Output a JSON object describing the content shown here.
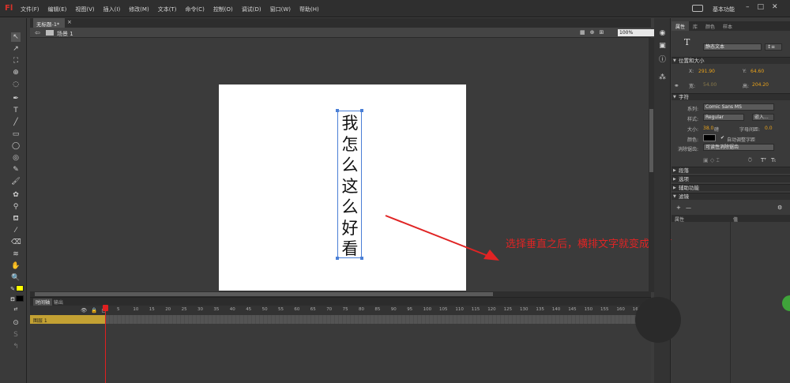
{
  "app": {
    "logo": "Fl",
    "menus": [
      "文件(F)",
      "编辑(E)",
      "视图(V)",
      "插入(I)",
      "修改(M)",
      "文本(T)",
      "命令(C)",
      "控制(O)",
      "调试(D)",
      "窗口(W)",
      "帮助(H)"
    ],
    "workspace_label": "基本功能",
    "window_buttons": [
      "–",
      "□",
      "✕"
    ]
  },
  "document": {
    "tab_label": "无标题-1*",
    "tab_close": "×",
    "back": "⇦",
    "scene_label": "场景 1",
    "zoom_value": "100%",
    "scene_icons": [
      "▦",
      "⊕",
      "⊞"
    ]
  },
  "stage": {
    "vertical_text": [
      "我",
      "怎",
      "么",
      "这",
      "么",
      "好",
      "看"
    ]
  },
  "annotation": {
    "text": "选择垂直之后，横排文字就变成竖排了",
    "color": "#e02424"
  },
  "timeline": {
    "tabs": [
      "时间轴",
      "输出"
    ],
    "header_icons": [
      "👁",
      "🔒",
      "▢"
    ],
    "frame_numbers": [
      "1",
      "5",
      "10",
      "15",
      "20",
      "25",
      "30",
      "35",
      "40",
      "45",
      "50",
      "55",
      "60",
      "65",
      "70",
      "75",
      "80",
      "85",
      "90",
      "95",
      "100",
      "105",
      "110",
      "115",
      "120",
      "125",
      "130",
      "135",
      "140",
      "145",
      "150",
      "155",
      "160",
      "16"
    ],
    "layer_name": "图层 1",
    "layer_color": "#c3a133"
  },
  "tools": {
    "stroke_color": "#ffff00",
    "fill_color": "#000000"
  },
  "properties": {
    "tabs": [
      "属性",
      "库",
      "颜色",
      "样本"
    ],
    "tool_glyph": "T",
    "text_type": "静态文本",
    "orientation_icon": "↕≡",
    "sections": {
      "position": "位置和大小",
      "character": "字符",
      "paragraph": "段落",
      "options": "选项",
      "accessibility": "辅助功能",
      "filters": "滤镜"
    },
    "x_label": "X:",
    "x_value": "291.90",
    "y_label": "Y:",
    "y_value": "64.60",
    "w_label": "宽:",
    "w_value": "54.00",
    "h_label": "高:",
    "h_value": "204.20",
    "family_label": "系列:",
    "family_value": "Comic Sans MS",
    "style_label": "样式:",
    "style_value": "Regular",
    "embed_label": "嵌入...",
    "size_label": "大小:",
    "size_value": "38.0",
    "size_unit": "磅",
    "spacing_label": "字母间距:",
    "spacing_value": "0.0",
    "color_label": "颜色:",
    "auto_kern_label": "自动调整字距",
    "antialias_label": "消除锯齿:",
    "antialias_value": "可读性消除锯齿",
    "filter_prop_header": "属性",
    "filter_value_header": "值",
    "add_filter": "+",
    "remove_filter": "—",
    "filter_settings": "⚙"
  }
}
